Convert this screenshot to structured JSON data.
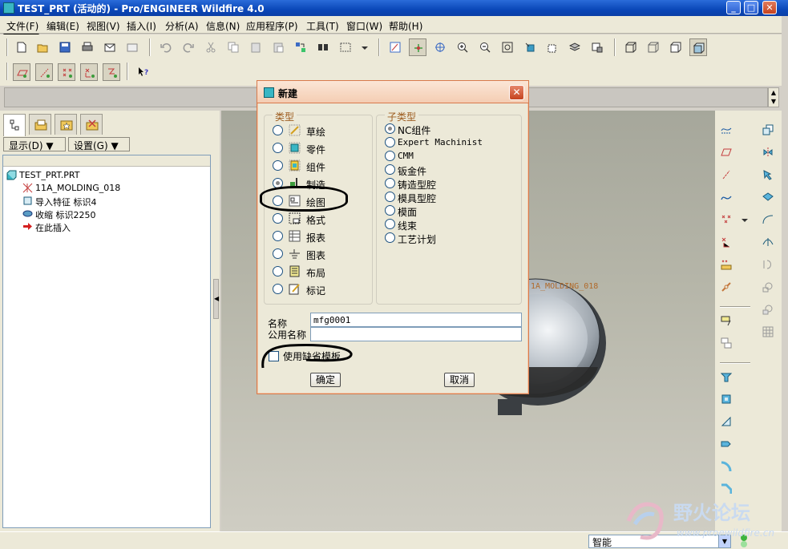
{
  "window": {
    "title": "TEST_PRT (活动的) - Pro/ENGINEER Wildfire 4.0",
    "minimize": "_",
    "maximize": "□",
    "close": "✕"
  },
  "menu": [
    "文件(F)",
    "编辑(E)",
    "视图(V)",
    "插入(I)",
    "分析(A)",
    "信息(N)",
    "应用程序(P)",
    "工具(T)",
    "窗口(W)",
    "帮助(H)"
  ],
  "toolbar_icons": {
    "row1": [
      "new-file",
      "open-file",
      "save",
      "print",
      "email",
      "email-attach",
      "undo",
      "redo",
      "cut",
      "copy",
      "paste",
      "paste-special",
      "regenerate",
      "find",
      "select-box",
      "dropdown",
      "datum-plane-display",
      "datum-axis-display",
      "datum-point-display",
      "zoom-in",
      "zoom-out",
      "refit",
      "reorient",
      "saved-views",
      "layers",
      "view-manager",
      "wireframe",
      "hidden-line",
      "no-hidden",
      "shading"
    ],
    "row2": [
      "datum-plane-toggle",
      "datum-axis-toggle",
      "point-toggle",
      "coord-sys-toggle",
      "spin-center",
      "whats-this"
    ]
  },
  "tree_panel": {
    "tabs": [
      "model-tree",
      "folder-browser",
      "favorites",
      "connections"
    ],
    "show_button": "显示(D) ▼",
    "settings_button": "设置(G) ▼",
    "items": [
      {
        "label": "TEST_PRT.PRT",
        "icon": "part-icon"
      },
      {
        "label": "11A_MOLDING_018",
        "icon": "coordsys-icon"
      },
      {
        "label": "导入特征 标识4",
        "icon": "import-icon"
      },
      {
        "label": "收缩 标识2250",
        "icon": "shrink-icon"
      },
      {
        "label": "在此插入",
        "icon": "insert-arrow-icon"
      }
    ]
  },
  "graphics": {
    "part_label": "1A_MOLDING_018"
  },
  "dialog": {
    "title": "新建",
    "close": "✕",
    "type_group": "类型",
    "types": [
      {
        "label": "草绘",
        "state": "unchecked"
      },
      {
        "label": "零件",
        "state": "unchecked"
      },
      {
        "label": "组件",
        "state": "unchecked"
      },
      {
        "label": "制造",
        "state": "checked"
      },
      {
        "label": "绘图",
        "state": "unchecked"
      },
      {
        "label": "格式",
        "state": "unchecked"
      },
      {
        "label": "报表",
        "state": "unchecked"
      },
      {
        "label": "图表",
        "state": "unchecked"
      },
      {
        "label": "布局",
        "state": "unchecked"
      },
      {
        "label": "标记",
        "state": "unchecked"
      }
    ],
    "subtype_group": "子类型",
    "subtypes": [
      {
        "label": "NC组件",
        "state": "checked"
      },
      {
        "label": "Expert Machinist",
        "state": "unchecked"
      },
      {
        "label": "CMM",
        "state": "unchecked"
      },
      {
        "label": "钣金件",
        "state": "unchecked"
      },
      {
        "label": "铸造型腔",
        "state": "unchecked"
      },
      {
        "label": "模具型腔",
        "state": "unchecked"
      },
      {
        "label": "模面",
        "state": "unchecked"
      },
      {
        "label": "线束",
        "state": "unchecked"
      },
      {
        "label": "工艺计划",
        "state": "unchecked"
      }
    ],
    "name_label": "名称",
    "name_value": "mfg0001",
    "common_name_label": "公用名称",
    "common_name_value": "",
    "use_default_template": "使用缺省模板",
    "ok": "确定",
    "cancel": "取消"
  },
  "status": {
    "filter_value": "智能",
    "filter_arrow": "▼"
  },
  "watermark": {
    "text": "野火论坛",
    "url": "www.proewildfire.cn"
  },
  "colors": {
    "accent_title": "#0a47b8",
    "dialog_border": "#d87a4b",
    "group_title": "#9c5b1e",
    "radio_checked": "#21a121"
  }
}
